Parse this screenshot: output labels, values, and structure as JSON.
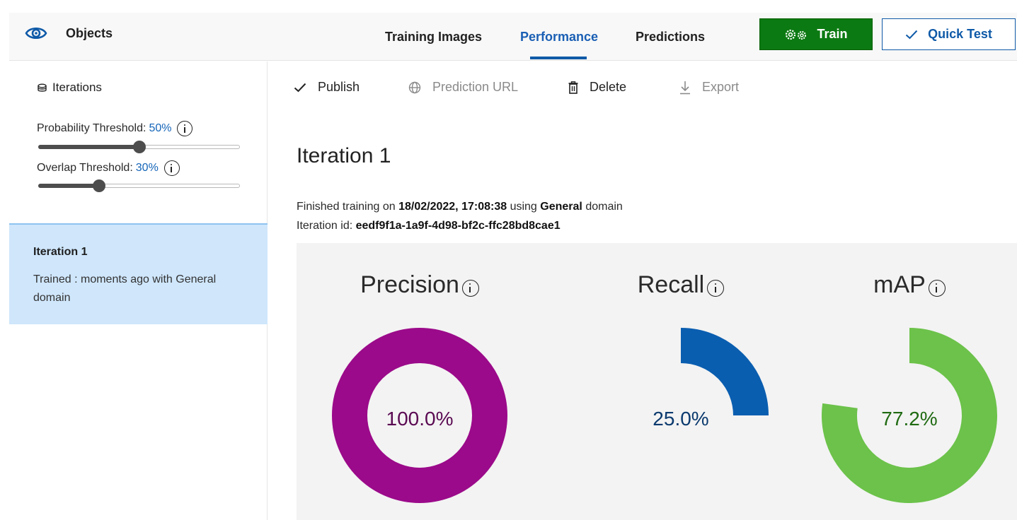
{
  "header": {
    "app_icon": "eye-icon",
    "project_name": "Objects",
    "tabs": [
      {
        "label": "Training Images",
        "active": false
      },
      {
        "label": "Performance",
        "active": true
      },
      {
        "label": "Predictions",
        "active": false
      }
    ],
    "train_button": {
      "label": "Train",
      "icon": "gears-icon"
    },
    "quick_test_button": {
      "label": "Quick Test",
      "icon": "check-icon"
    },
    "accent_color": "#0f5aa8",
    "train_color": "#0c7a12"
  },
  "sidebar": {
    "iterations_header": "Iterations",
    "probability_threshold": {
      "label": "Probability Threshold:",
      "value_text": "50%",
      "value": 50
    },
    "overlap_threshold": {
      "label": "Overlap Threshold:",
      "value_text": "30%",
      "value": 30
    },
    "iteration_card": {
      "title": "Iteration 1",
      "subtitle": "Trained : moments ago with General domain"
    }
  },
  "toolbar": {
    "publish": "Publish",
    "prediction_url": "Prediction URL",
    "delete": "Delete",
    "export": "Export"
  },
  "main": {
    "title": "Iteration 1",
    "finished_prefix": "Finished training on",
    "finished_date": "18/02/2022, 17:08:38",
    "using_text": "using",
    "domain": "General",
    "domain_suffix": "domain",
    "iteration_id_label": "Iteration id:",
    "iteration_id": "eedf9f1a-1a9f-4d98-bf2c-ffc28bd8cae1"
  },
  "metrics": {
    "precision": {
      "label": "Precision",
      "value_text": "100.0%",
      "value": 100.0,
      "color": "#9b0a8a",
      "text_color": "#5a0a52"
    },
    "recall": {
      "label": "Recall",
      "value_text": "25.0%",
      "value": 25.0,
      "color": "#0a5eb0",
      "text_color": "#0b3a6e"
    },
    "map": {
      "label": "mAP",
      "value_text": "77.2%",
      "value": 77.2,
      "color": "#6cc24a",
      "text_color": "#1f6a12"
    }
  }
}
